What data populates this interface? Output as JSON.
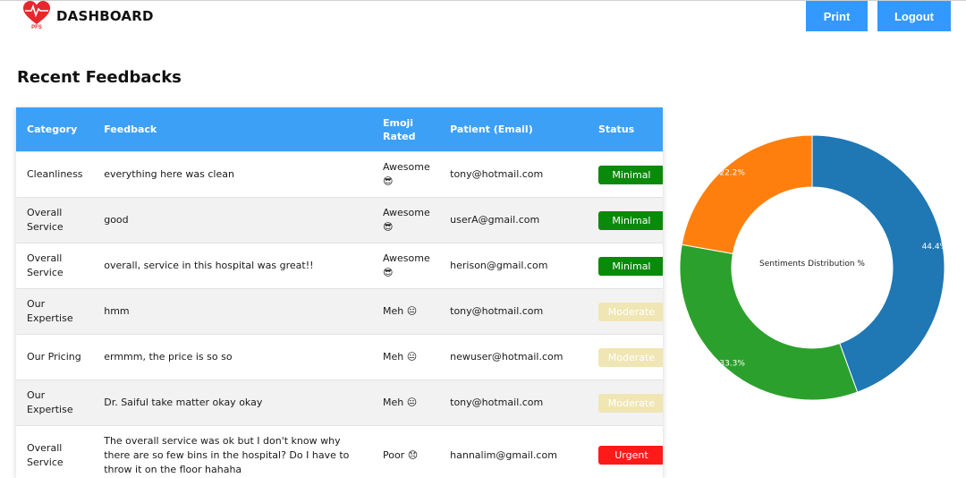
{
  "header": {
    "title": "DASHBOARD",
    "logo_text": "PFS",
    "print_label": "Print",
    "logout_label": "Logout"
  },
  "section_title": "Recent Feedbacks",
  "table": {
    "columns": [
      "Category",
      "Feedback",
      "Emoji Rated",
      "Patient (Email)",
      "Status"
    ],
    "rows": [
      {
        "category": "Cleanliness",
        "feedback": "everything here was clean",
        "emoji": "Awesome 😎",
        "email": "tony@hotmail.com",
        "status": "Minimal"
      },
      {
        "category": "Overall Service",
        "feedback": "good",
        "emoji": "Awesome 😎",
        "email": "userA@gmail.com",
        "status": "Minimal"
      },
      {
        "category": "Overall Service",
        "feedback": "overall, service in this hospital was great!!",
        "emoji": "Awesome 😎",
        "email": "herison@gmail.com",
        "status": "Minimal"
      },
      {
        "category": "Our Expertise",
        "feedback": "hmm",
        "emoji": "Meh 😐",
        "email": "tony@hotmail.com",
        "status": "Moderate"
      },
      {
        "category": "Our Pricing",
        "feedback": "ermmm, the price is so so",
        "emoji": "Meh 😐",
        "email": "newuser@hotmail.com",
        "status": "Moderate"
      },
      {
        "category": "Our Expertise",
        "feedback": "Dr. Saiful take matter okay okay",
        "emoji": "Meh 😐",
        "email": "tony@hotmail.com",
        "status": "Moderate"
      },
      {
        "category": "Overall Service",
        "feedback": "The overall service was ok but I don't know why there are so few bins in the hospital? Do I have to throw it on the floor hahaha",
        "emoji": "Poor 😞",
        "email": "hannalim@gmail.com",
        "status": "Urgent"
      }
    ]
  },
  "colors": {
    "accent": "#3399ff",
    "header_bg": "#3da0f7",
    "minimal": "#0a8a0a",
    "moderate": "#f0e6b4",
    "urgent": "#ff1a1a"
  },
  "chart_data": {
    "type": "pie",
    "title": "Sentiments Distribution %",
    "donut": true,
    "slices": [
      {
        "label": "44.4%",
        "value": 44.4,
        "color": "#1f77b4"
      },
      {
        "label": "33.3%",
        "value": 33.3,
        "color": "#2ca02c"
      },
      {
        "label": "22.2%",
        "value": 22.2,
        "color": "#ff7f0e"
      }
    ]
  }
}
